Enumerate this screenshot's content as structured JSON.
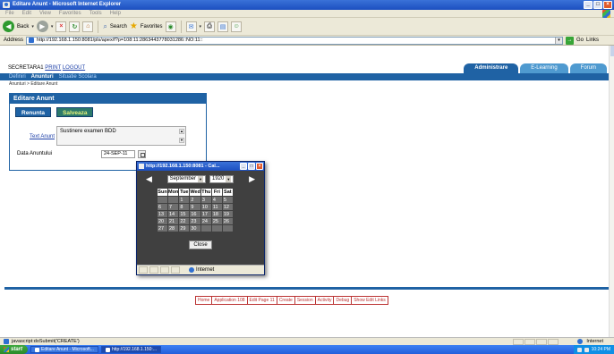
{
  "window": {
    "title": "Editare Anunt - Microsoft Internet Explorer",
    "controls": {
      "minimize": "_",
      "maximize": "□",
      "close": "×"
    }
  },
  "menu": [
    "File",
    "Edit",
    "View",
    "Favorites",
    "Tools",
    "Help"
  ],
  "toolbar": {
    "back_label": "Back",
    "search_label": "Search",
    "favorites_label": "Favorites",
    "icons": [
      "back-icon",
      "forward-icon",
      "stop-icon",
      "refresh-icon",
      "home-icon",
      "search-icon",
      "favorites-icon",
      "media-icon",
      "mail-icon",
      "print-icon",
      "messenger-icon"
    ]
  },
  "address": {
    "label": "Address",
    "url": "http://192.168.1.150:8081/pls/apex/f?p=108:11:2863443778031286::NO:11::",
    "go_label": "Go",
    "links_label": "Links"
  },
  "page": {
    "user_prefix": "SECRETARA1",
    "user_link": "Print",
    "logout_link": "Logout",
    "tabs": [
      {
        "label": "Administrare",
        "active": true
      },
      {
        "label": "E-Learning",
        "active": false
      },
      {
        "label": "Forum",
        "active": false
      }
    ],
    "nav": [
      {
        "label": "Definiri",
        "active": false
      },
      {
        "label": "Anunturi",
        "active": true
      },
      {
        "label": "Situatie Scolara",
        "active": false
      }
    ],
    "breadcrumb": "Anunturi > Editare Anunt",
    "panel": {
      "title": "Editare Anunt",
      "cancel_label": "Renunta",
      "save_label": "Salveaza",
      "text_label": "Text Anunt",
      "text_value": "Sustinere examen BDD",
      "date_label": "Data Anuntului",
      "date_value": "24-SEP-11"
    },
    "footer_links": [
      "Home",
      "Application 108",
      "Edit Page 11",
      "Create",
      "Session",
      "Activity",
      "Debug",
      "Show Edit Links"
    ]
  },
  "popup": {
    "title": "http://192.168.1.150:8081 - Cal...",
    "month": "September",
    "year": "1920",
    "weekdays": [
      "Sun",
      "Mon",
      "Tue",
      "Wed",
      "Thu",
      "Fri",
      "Sat"
    ],
    "weeks": [
      [
        "",
        "",
        "1",
        "2",
        "3",
        "4",
        "5"
      ],
      [
        "6",
        "7",
        "8",
        "9",
        "10",
        "11",
        "12"
      ],
      [
        "13",
        "14",
        "15",
        "16",
        "17",
        "18",
        "19"
      ],
      [
        "20",
        "21",
        "22",
        "23",
        "24",
        "25",
        "26"
      ],
      [
        "27",
        "28",
        "29",
        "30",
        "",
        "",
        ""
      ]
    ],
    "close_label": "Close",
    "status_zone": "Internet"
  },
  "statusbar": {
    "text": "javascript:doSubmit('CREATE')",
    "zone": "Internet"
  },
  "taskbar": {
    "start_label": "start",
    "buttons": [
      {
        "label": "Editare Anunt - Microsoft...",
        "active": false
      },
      {
        "label": "http://192.168.1.150:...",
        "active": true
      }
    ],
    "clock": "10:24 PM"
  },
  "colors": {
    "brand_blue": "#1f62a4",
    "tab_light": "#4f9ad0",
    "footer_red": "#b33333"
  }
}
